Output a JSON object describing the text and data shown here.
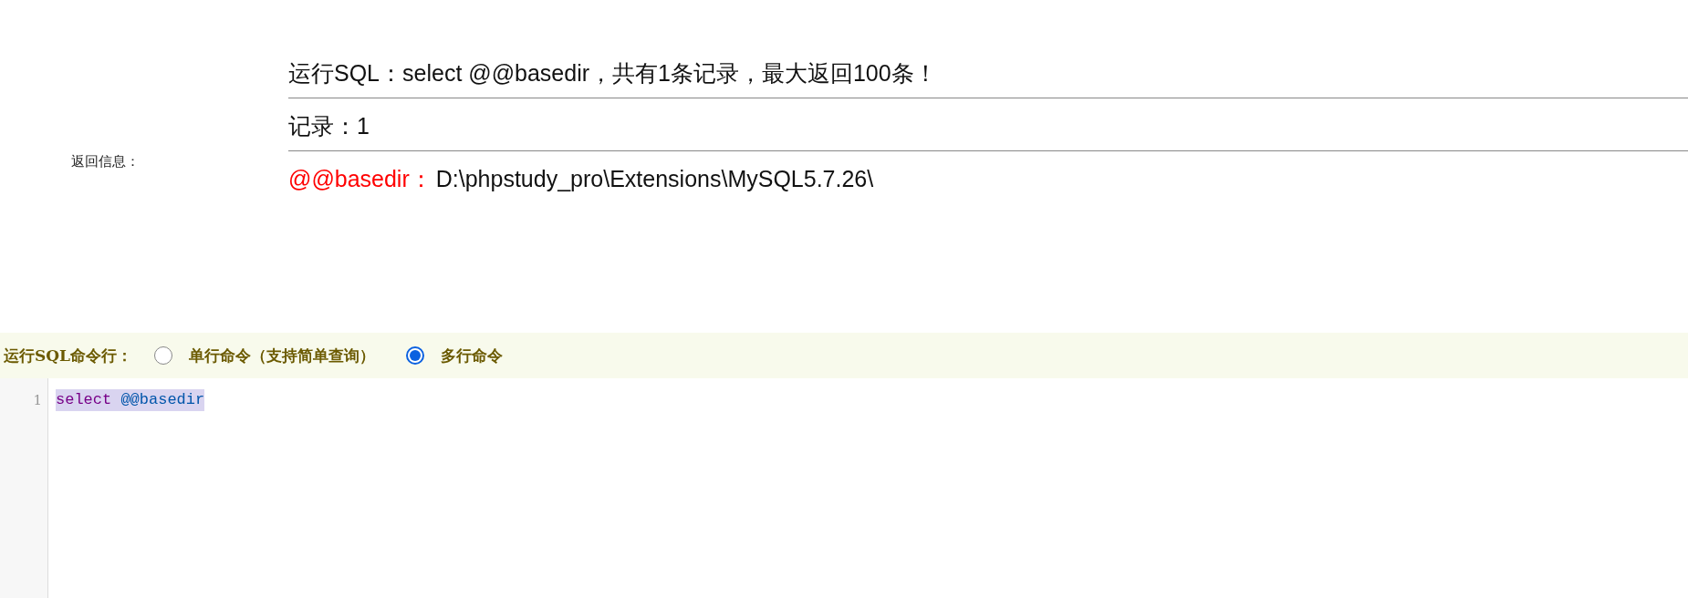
{
  "result": {
    "label": "返回信息：",
    "summary": "运行SQL：select @@basedir，共有1条记录，最大返回100条！",
    "count": "记录：1",
    "fields": [
      {
        "name": "@@basedir：",
        "value": "D:\\phpstudy_pro\\Extensions\\MySQL5.7.26\\"
      }
    ]
  },
  "mode": {
    "label": "运行SQL命令行：",
    "options": [
      {
        "label": "单行命令（支持简单查询）",
        "selected": false
      },
      {
        "label": "多行命令",
        "selected": true
      }
    ]
  },
  "editor": {
    "lines": [
      {
        "number": "1",
        "selected": true,
        "tokens": [
          {
            "kind": "keyword",
            "text": "select"
          },
          {
            "kind": "variable",
            "text": "@@basedir"
          }
        ]
      }
    ]
  }
}
